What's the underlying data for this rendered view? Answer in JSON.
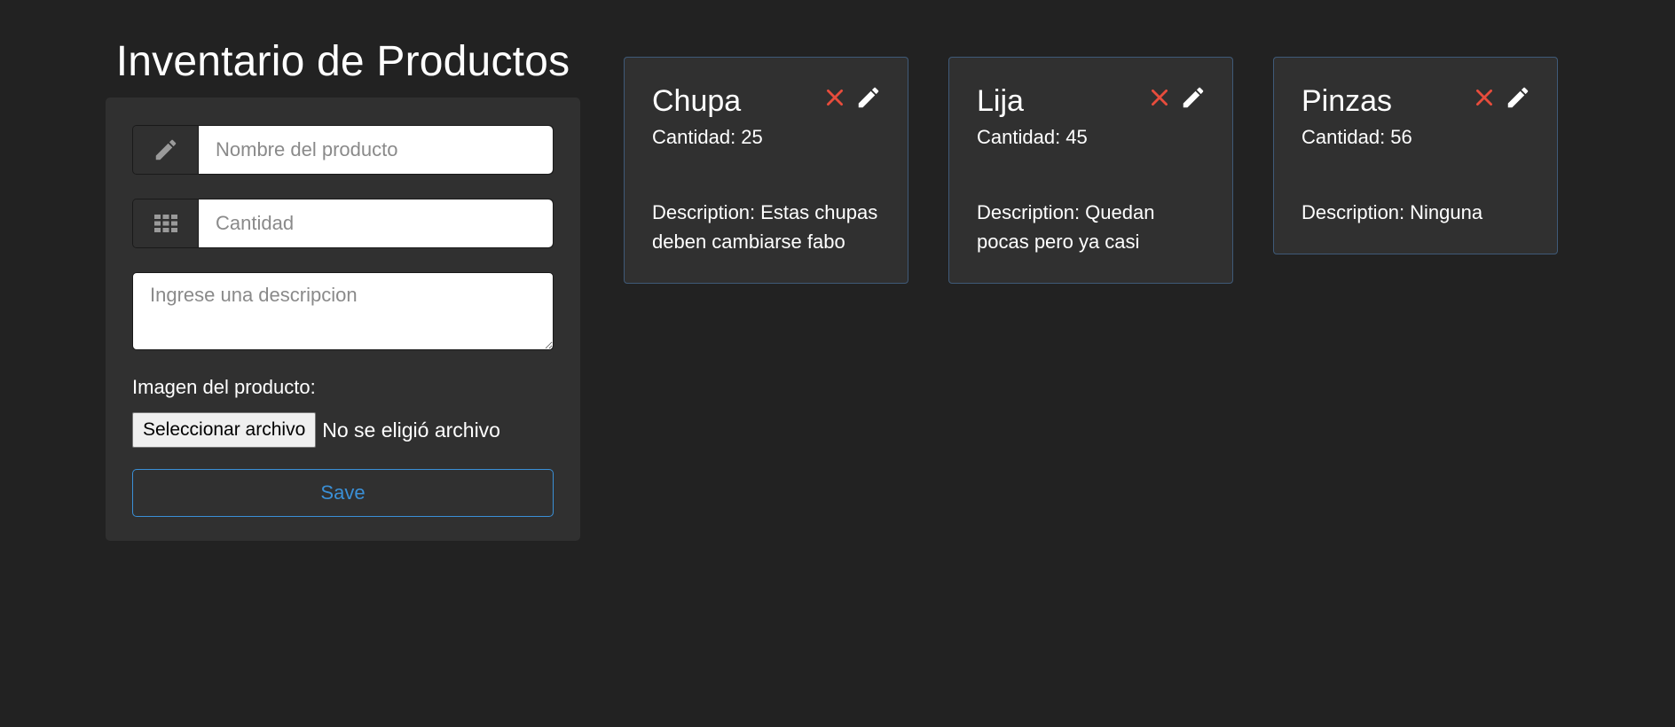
{
  "page": {
    "title": "Inventario de Productos"
  },
  "form": {
    "name_placeholder": "Nombre del producto",
    "name_value": "",
    "quantity_placeholder": "Cantidad",
    "quantity_value": "",
    "description_placeholder": "Ingrese una descripcion",
    "description_value": "",
    "image_label": "Imagen del producto:",
    "file_button_label": "Seleccionar archivo",
    "file_status": "No se eligió archivo",
    "save_label": "Save",
    "name_icon": "pencil-icon",
    "quantity_icon": "grid-icon"
  },
  "products": [
    {
      "name": "Chupa",
      "quantity_label": "Cantidad: 25",
      "description_label": "Description:",
      "description": "Estas chupas deben cambiarse fabo"
    },
    {
      "name": "Lija",
      "quantity_label": "Cantidad: 45",
      "description_label": "Description:",
      "description": "Quedan pocas pero ya casi"
    },
    {
      "name": "Pinzas",
      "quantity_label": "Cantidad: 56",
      "description_label": "Description:",
      "description": "Ninguna"
    }
  ],
  "colors": {
    "background": "#222222",
    "panel": "#303030",
    "accent": "#3a8fd6",
    "delete": "#e74c3c",
    "card_border": "#3f5a78"
  },
  "icons": {
    "delete": "close-icon",
    "edit": "pencil-icon"
  }
}
